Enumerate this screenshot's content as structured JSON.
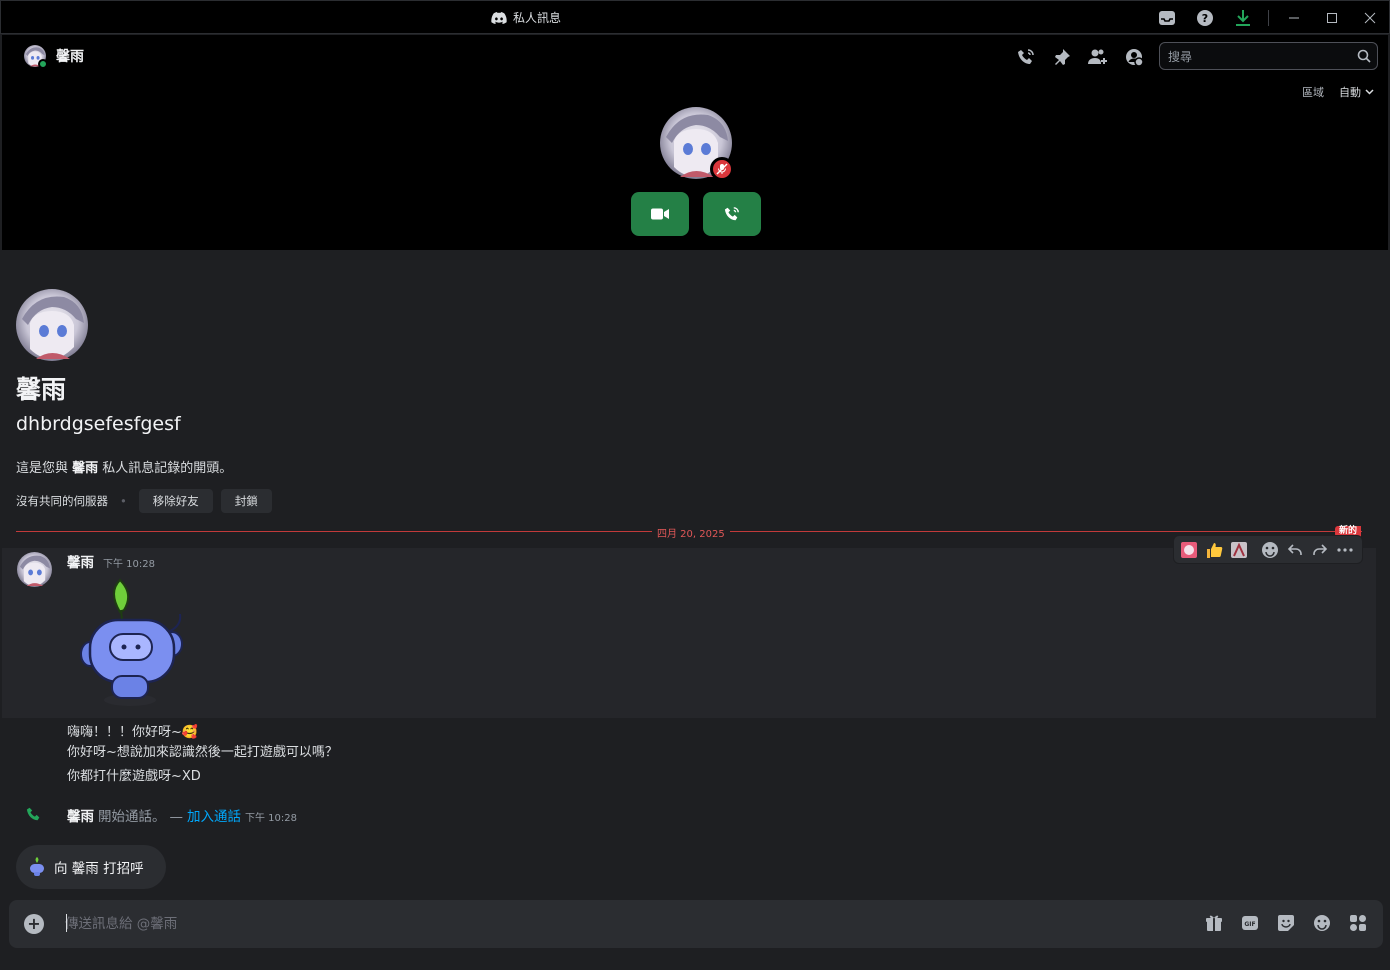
{
  "window": {
    "title": "私人訊息"
  },
  "header": {
    "dm_name": "馨雨",
    "search_placeholder": "搜尋",
    "region_label": "區域",
    "region_value": "自動"
  },
  "intro": {
    "display_name": "馨雨",
    "username": "dhbrdgsefesfgesf",
    "text_prefix": "這是您與 ",
    "text_name": "馨雨",
    "text_suffix": " 私人訊息記錄的開頭。",
    "no_mutual": "沒有共同的伺服器",
    "bullet": "•",
    "remove_friend": "移除好友",
    "block": "封鎖"
  },
  "divider": {
    "date": "四月 20, 2025",
    "new_tag": "新的"
  },
  "message": {
    "author": "馨雨",
    "time": "下午 10:28",
    "lines": [
      "嗨嗨！！！你好呀~🥰",
      "你好呀~想說加來認識然後一起打遊戲可以嗎？",
      "你都打什麼遊戲呀~XD"
    ]
  },
  "system": {
    "name": "馨雨",
    "action": "開始通話。",
    "dash": "—",
    "join": "加入通話",
    "time": "下午 10:28"
  },
  "wave": {
    "label": "向 馨雨 打招呼"
  },
  "composer": {
    "placeholder": "傳送訊息給 @馨雨"
  },
  "colors": {
    "accent_green": "#248046",
    "danger_red": "#da373c",
    "link_blue": "#00a8fc",
    "online": "#23a55a"
  }
}
